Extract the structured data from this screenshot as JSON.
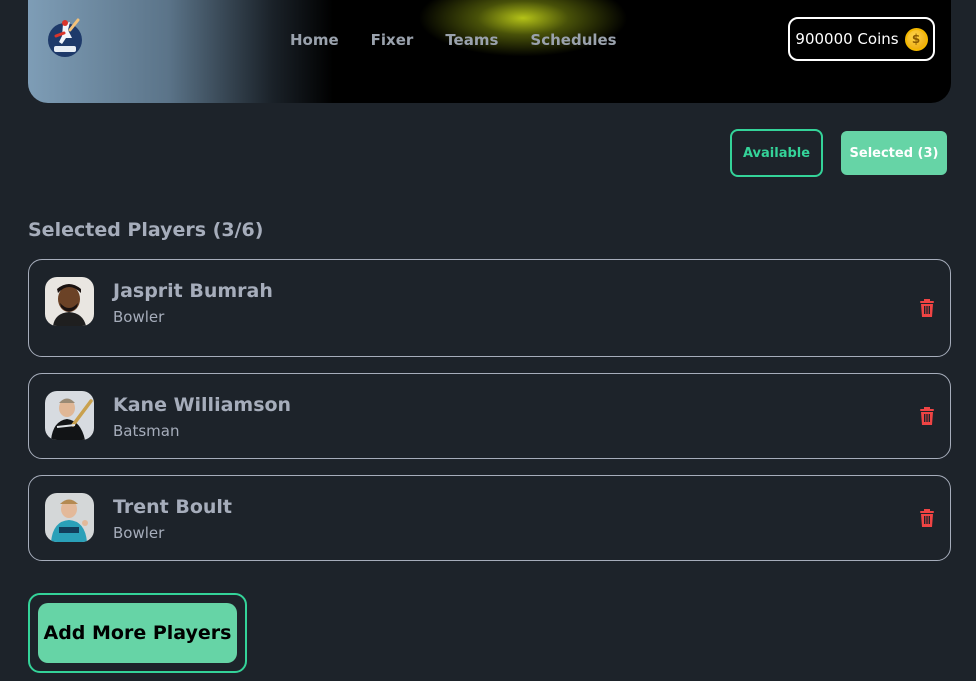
{
  "header": {
    "logo_icon": "cricket-logo-icon",
    "nav": [
      "Home",
      "Fixer",
      "Teams",
      "Schedules"
    ],
    "coins_label": "900000 Coins",
    "coin_icon": "dollar-coin-icon",
    "coin_symbol": "$"
  },
  "tabs": {
    "available": "Available",
    "selected": "Selected (3)"
  },
  "section_title": "Selected Players (3/6)",
  "players": [
    {
      "name": "Jasprit Bumrah",
      "role": "Bowler"
    },
    {
      "name": "Kane Williamson",
      "role": "Batsman"
    },
    {
      "name": "Trent Boult",
      "role": "Bowler"
    }
  ],
  "add_button": "Add More Players",
  "colors": {
    "accent": "#34d399",
    "button_fill": "#66d4a6",
    "delete": "#ef4444",
    "background": "#1d232a"
  }
}
